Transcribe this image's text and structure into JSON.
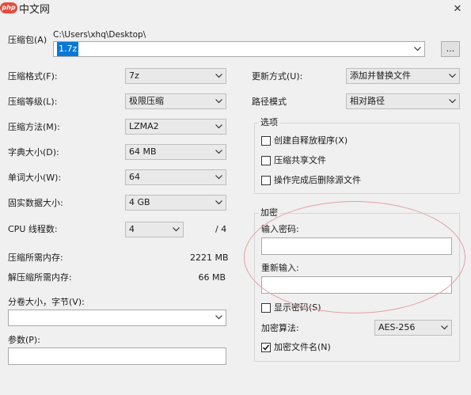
{
  "watermark": {
    "text": "中文网",
    "logo_text": "php"
  },
  "window": {
    "close_glyph": "✕"
  },
  "archive": {
    "label": "压缩包(A)",
    "path": "C:\\Users\\xhq\\Desktop\\",
    "filename": "1.7z",
    "browse_label": "..."
  },
  "left_settings": [
    {
      "label": "压缩格式(F):",
      "value": "7z"
    },
    {
      "label": "压缩等级(L):",
      "value": "极限压缩"
    },
    {
      "label": "压缩方法(M):",
      "value": "LZMA2"
    },
    {
      "label": "字典大小(D):",
      "value": "64 MB"
    },
    {
      "label": "单词大小(W):",
      "value": "64"
    },
    {
      "label": "固实数据大小:",
      "value": "4 GB"
    }
  ],
  "cpu": {
    "label": "CPU 线程数:",
    "value": "4",
    "total": "/ 4"
  },
  "memory": {
    "compress_label": "压缩所需内存:",
    "compress_value": "2221 MB",
    "decompress_label": "解压缩所需内存:",
    "decompress_value": "66 MB"
  },
  "split": {
    "label": "分卷大小，字节(V):",
    "value": ""
  },
  "params": {
    "label": "参数(P):",
    "value": ""
  },
  "update_mode": {
    "label": "更新方式(U):",
    "value": "添加并替换文件"
  },
  "path_mode": {
    "label": "路径模式",
    "value": "相对路径"
  },
  "options": {
    "title": "选项",
    "items": [
      {
        "label": "创建自释放程序(X)",
        "checked": false
      },
      {
        "label": "压缩共享文件",
        "checked": false
      },
      {
        "label": "操作完成后删除源文件",
        "checked": false
      }
    ]
  },
  "encryption": {
    "title": "加密",
    "password_label": "输入密码:",
    "password_value": "",
    "reenter_label": "重新输入:",
    "reenter_value": "",
    "show_password_label": "显示密码(S)",
    "show_password_checked": false,
    "method_label": "加密算法:",
    "method_value": "AES-256",
    "encrypt_names_label": "加密文件名(N)",
    "encrypt_names_checked": true
  },
  "colors": {
    "highlight": "#0a78d7",
    "annotation": "#e3a0a6"
  }
}
